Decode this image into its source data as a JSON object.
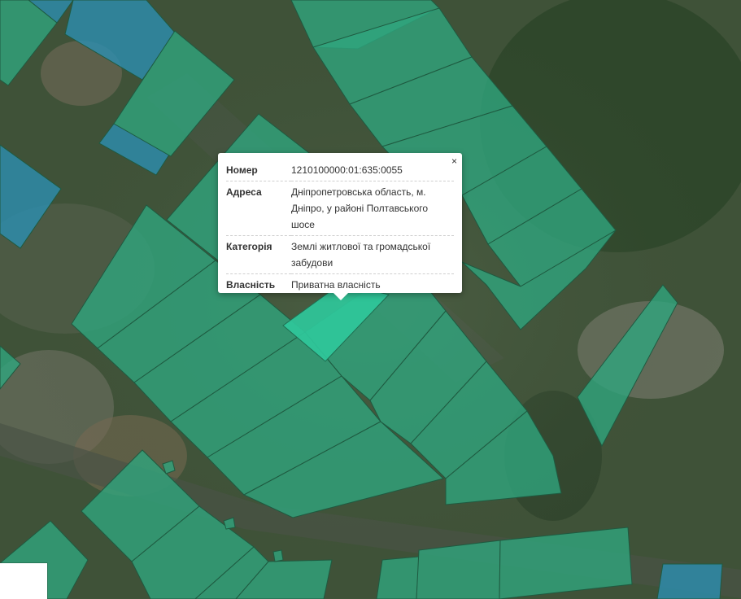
{
  "map": {
    "colors": {
      "parcel_green": "#2fa77f",
      "parcel_blue": "#2c8fb3",
      "parcel_selected": "#2fc79a",
      "parcel_border": "#1f5a40",
      "imagery_base": "#3d4f37"
    }
  },
  "popup": {
    "close_icon": "close-icon",
    "close_glyph": "×",
    "rows": [
      {
        "label": "Номер",
        "value": "1210100000:01:635:0055"
      },
      {
        "label": "Адреса",
        "value": "Дніпропетровська область, м. Дніпро, у районі Полтавського шосе"
      },
      {
        "label": "Категорія",
        "value": "Землі житлової та громадської забудови"
      },
      {
        "label": "Власність",
        "value": "Приватна власність"
      }
    ]
  }
}
